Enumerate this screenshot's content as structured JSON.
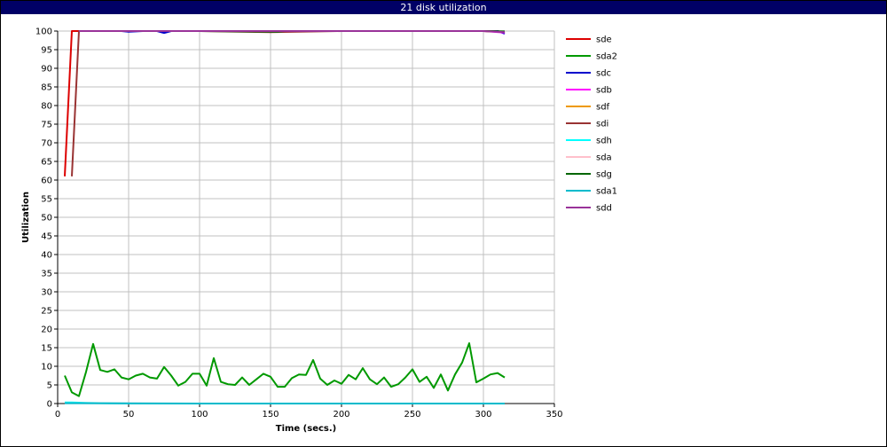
{
  "window": {
    "title": "21 disk utilization"
  },
  "chart_data": {
    "type": "line",
    "title": "21 disk utilization",
    "xlabel": "Time (secs.)",
    "ylabel": "Utilization",
    "xlim": [
      0,
      350
    ],
    "ylim": [
      0,
      100
    ],
    "xticks": [
      0,
      50,
      100,
      150,
      200,
      250,
      300,
      350
    ],
    "yticks": [
      0,
      5,
      10,
      15,
      20,
      25,
      30,
      35,
      40,
      45,
      50,
      55,
      60,
      65,
      70,
      75,
      80,
      85,
      90,
      95,
      100
    ],
    "grid": true,
    "legend_position": "right",
    "series": [
      {
        "name": "sde",
        "color": "#dd0000",
        "x": [
          5,
          10,
          15,
          20,
          40,
          60,
          80,
          100,
          120,
          140,
          160,
          180,
          200,
          220,
          240,
          260,
          280,
          300,
          310,
          315
        ],
        "y": [
          61,
          100,
          100,
          100,
          100,
          100,
          100,
          100,
          100,
          100,
          100,
          100,
          100,
          100,
          100,
          100,
          100,
          100,
          100,
          99.5
        ]
      },
      {
        "name": "sda2",
        "color": "#009900",
        "x": [
          5,
          10,
          15,
          20,
          25,
          30,
          35,
          40,
          45,
          50,
          55,
          60,
          65,
          70,
          75,
          80,
          85,
          90,
          95,
          100,
          105,
          110,
          115,
          120,
          125,
          130,
          135,
          140,
          145,
          150,
          155,
          160,
          165,
          170,
          175,
          180,
          185,
          190,
          195,
          200,
          205,
          210,
          215,
          220,
          225,
          230,
          235,
          240,
          245,
          250,
          255,
          260,
          265,
          270,
          275,
          280,
          285,
          290,
          295,
          300,
          305,
          310,
          315
        ],
        "y": [
          7.5,
          3,
          2,
          8.5,
          16,
          9,
          8.5,
          9.2,
          7,
          6.5,
          7.5,
          8,
          7,
          6.7,
          9.8,
          7.5,
          4.8,
          5.8,
          8,
          8,
          4.8,
          12.2,
          5.8,
          5.2,
          5,
          7,
          5,
          6.5,
          8,
          7.2,
          4.5,
          4.5,
          6.8,
          7.8,
          7.7,
          11.7,
          6.7,
          5,
          6.2,
          5.3,
          7.7,
          6.5,
          9.5,
          6.5,
          5.2,
          7,
          4.5,
          5.2,
          7,
          9.2,
          5.8,
          7.2,
          4.2,
          7.8,
          3.5,
          7.8,
          11,
          16.2,
          5.7,
          6.7,
          7.8,
          8.2,
          7
        ]
      },
      {
        "name": "sdc",
        "color": "#0000cc",
        "x": [
          15,
          40,
          45,
          50,
          60,
          70,
          75,
          80,
          100,
          150,
          200,
          250,
          300,
          310,
          315
        ],
        "y": [
          100,
          100,
          100,
          99.8,
          100,
          100,
          99.5,
          100,
          100,
          100,
          100,
          100,
          100,
          100,
          99.3
        ]
      },
      {
        "name": "sdb",
        "color": "#ff00ff",
        "x": [
          15,
          100,
          150,
          200,
          250,
          300,
          315
        ],
        "y": [
          100,
          100,
          100,
          100,
          100,
          100,
          99.6
        ]
      },
      {
        "name": "sdf",
        "color": "#ee9900",
        "x": [
          15,
          100,
          200,
          300,
          315
        ],
        "y": [
          100,
          100,
          100,
          100,
          99.8
        ]
      },
      {
        "name": "sdi",
        "color": "#993333",
        "x": [
          10,
          15,
          20,
          60,
          100,
          150,
          200,
          250,
          300,
          315
        ],
        "y": [
          61,
          100,
          100,
          100,
          100,
          99.7,
          100,
          100,
          100,
          99.8
        ]
      },
      {
        "name": "sdh",
        "color": "#00ffff",
        "x": [
          5,
          10,
          20,
          50,
          100,
          150,
          200,
          250,
          300,
          315
        ],
        "y": [
          0.3,
          0.3,
          0.2,
          0,
          0,
          0,
          0,
          0,
          0,
          0
        ]
      },
      {
        "name": "sda",
        "color": "#ffc0cb",
        "x": [
          5,
          20,
          100,
          200,
          300,
          315
        ],
        "y": [
          0.1,
          0.1,
          0,
          0,
          0,
          0
        ]
      },
      {
        "name": "sdg",
        "color": "#006600",
        "x": [
          15,
          100,
          155,
          160,
          200,
          250,
          300,
          315
        ],
        "y": [
          100,
          100,
          99.8,
          100,
          100,
          100,
          100,
          99.9
        ]
      },
      {
        "name": "sda1",
        "color": "#00bbcc",
        "x": [
          5,
          15,
          100,
          200,
          300,
          315
        ],
        "y": [
          0.1,
          0.1,
          0,
          0,
          0,
          0
        ]
      },
      {
        "name": "sdd",
        "color": "#993399",
        "x": [
          15,
          100,
          150,
          200,
          250,
          300,
          315
        ],
        "y": [
          100,
          100,
          100,
          100,
          100,
          100,
          99.7
        ]
      }
    ]
  }
}
